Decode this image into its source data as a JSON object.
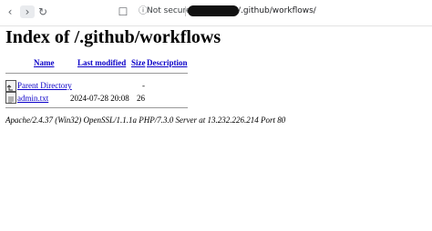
{
  "browser": {
    "security_label": "Not secure",
    "url_visible": "/.github/workflows/",
    "icons": [
      "back-icon",
      "forward-icon",
      "reload-icon",
      "bookmark-icon",
      "info-icon"
    ]
  },
  "page": {
    "title": "Index of /.github/workflows",
    "columns": {
      "name": "Name",
      "last_modified": "Last modified",
      "size": "Size",
      "description": "Description"
    },
    "rows": [
      {
        "name": "Parent Directory",
        "last_modified": "",
        "size": "-",
        "description": "",
        "icon": "back-folder-icon"
      },
      {
        "name": "admin.txt",
        "last_modified": "2024-07-28 20:08",
        "size": "26",
        "description": "",
        "icon": "text-file-icon"
      }
    ],
    "footer": "Apache/2.4.37 (Win32) OpenSSL/1.1.1a PHP/7.3.0 Server at 13.232.226.214 Port 80"
  }
}
